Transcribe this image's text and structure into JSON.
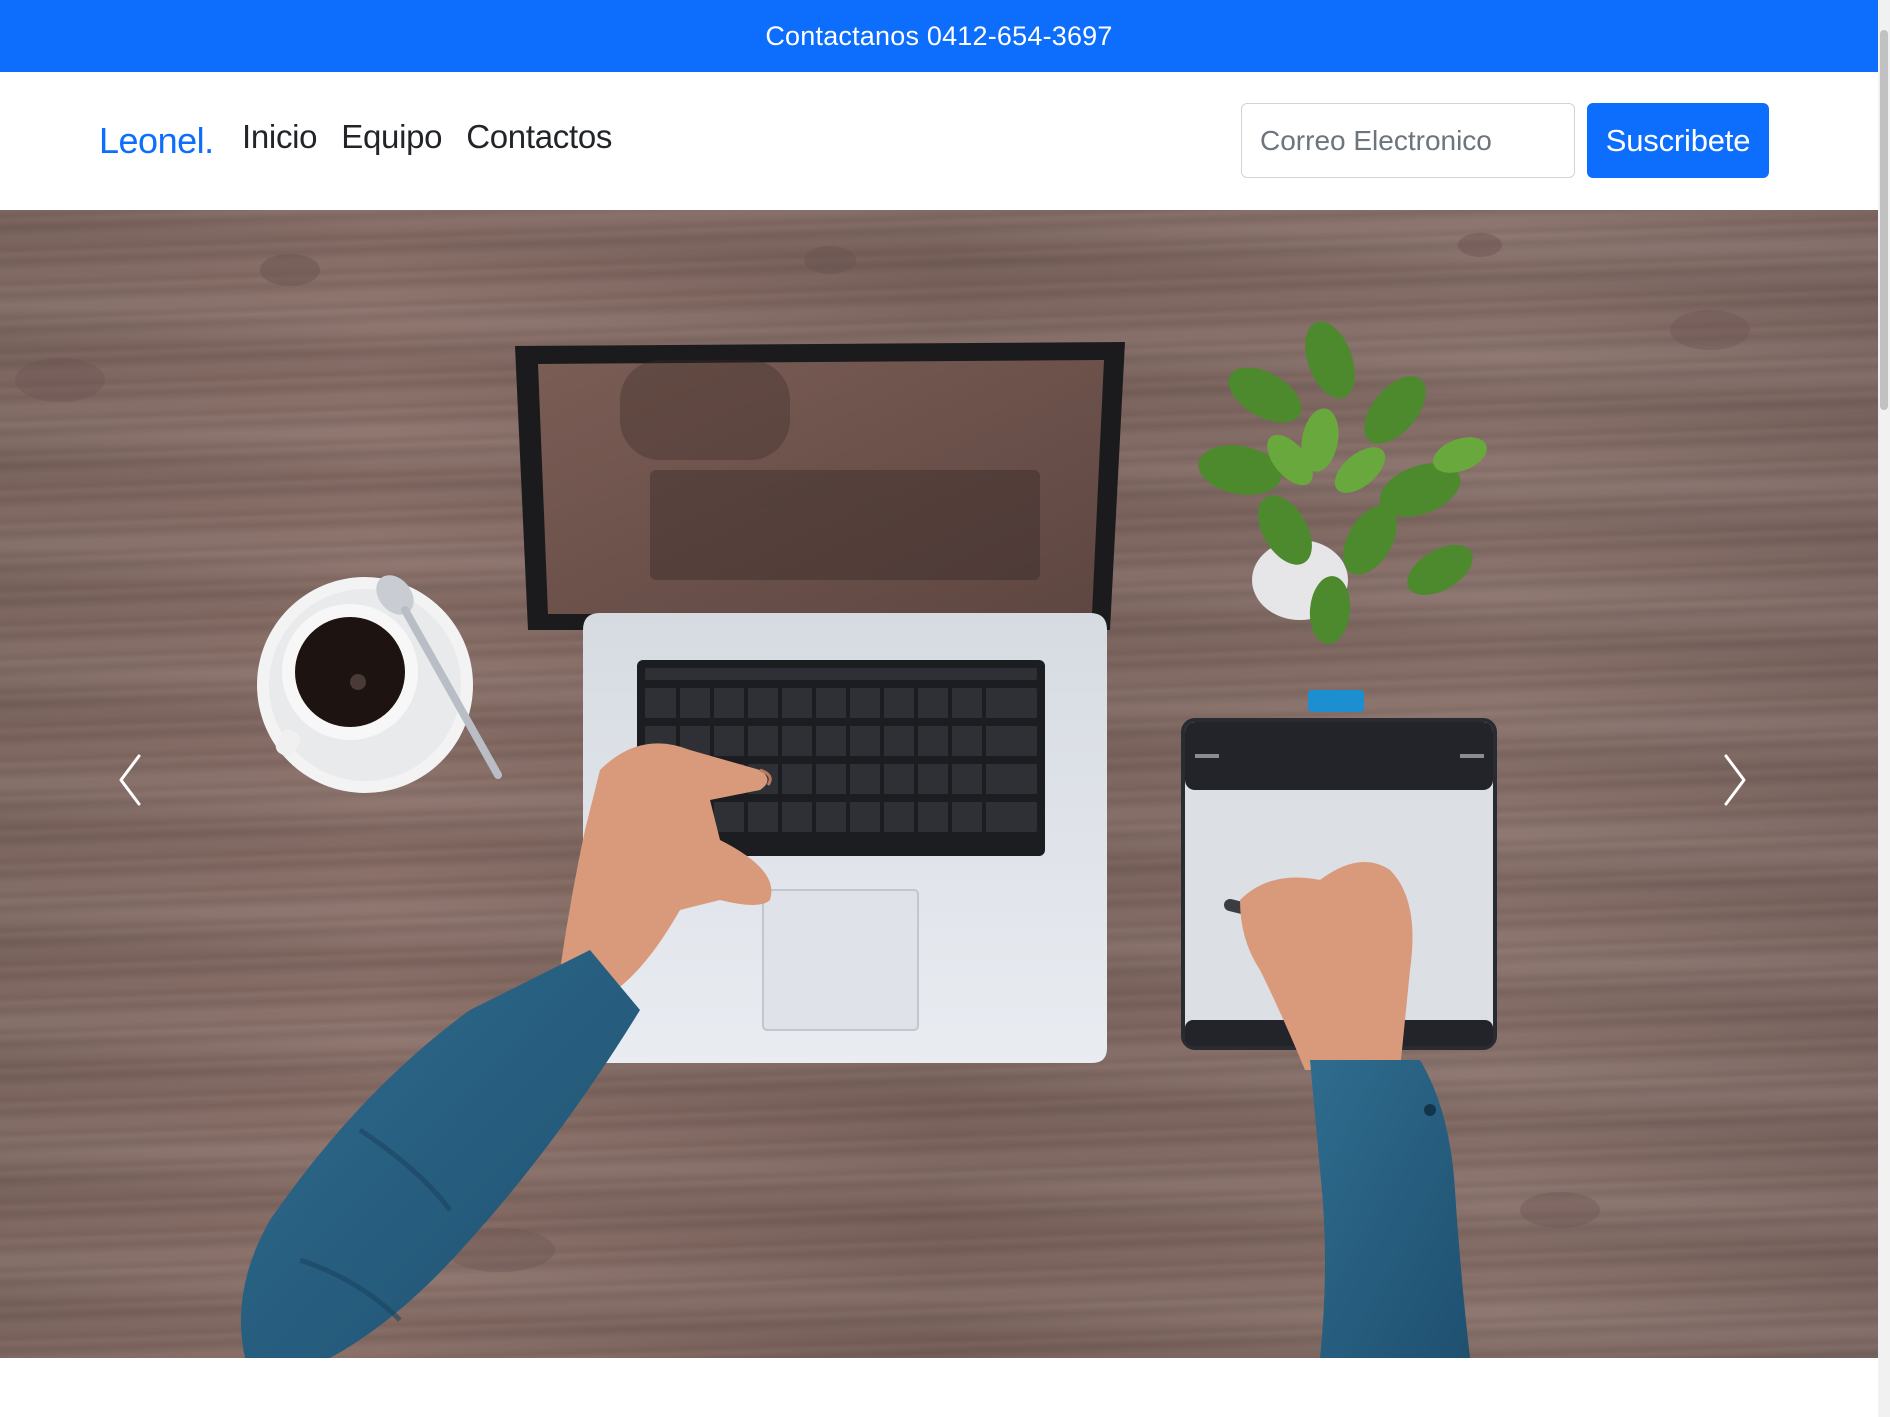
{
  "topbar": {
    "text": "Contactanos 0412-654-3697"
  },
  "navbar": {
    "brand": "Leonel.",
    "links": [
      {
        "label": "Inicio"
      },
      {
        "label": "Equipo"
      },
      {
        "label": "Contactos"
      }
    ],
    "email": {
      "placeholder": "Correo Electronico",
      "value": ""
    },
    "subscribe_label": "Suscribete"
  },
  "carousel": {
    "prev_icon": "chevron-left-icon",
    "next_icon": "chevron-right-icon",
    "slide_image": "desk-with-laptop-coffee-plant-tablet"
  },
  "colors": {
    "primary": "#0d6efd",
    "text": "#212529",
    "muted": "#6c757d"
  }
}
